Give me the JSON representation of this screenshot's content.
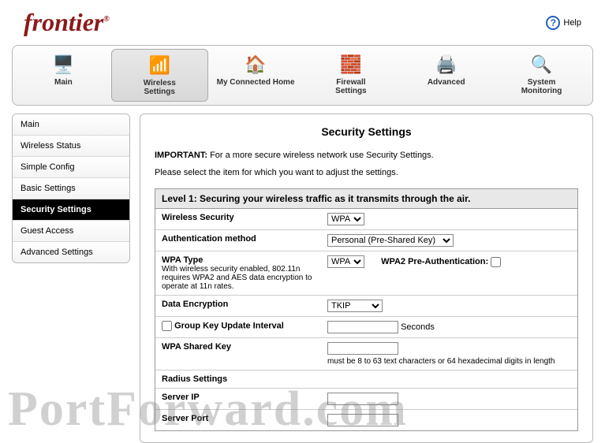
{
  "brand": "frontier",
  "help_label": "Help",
  "topnav": [
    {
      "label": "Main",
      "icon": "🖥️"
    },
    {
      "label": "Wireless\nSettings",
      "icon": "📶"
    },
    {
      "label": "My Connected Home",
      "icon": "🏠"
    },
    {
      "label": "Firewall\nSettings",
      "icon": "🧱"
    },
    {
      "label": "Advanced",
      "icon": "🖨️"
    },
    {
      "label": "System\nMonitoring",
      "icon": "🔍"
    }
  ],
  "sidebar": {
    "items": [
      {
        "label": "Main"
      },
      {
        "label": "Wireless Status"
      },
      {
        "label": "Simple Config"
      },
      {
        "label": "Basic Settings"
      },
      {
        "label": "Security Settings"
      },
      {
        "label": "Guest Access"
      },
      {
        "label": "Advanced Settings"
      }
    ]
  },
  "page": {
    "title": "Security Settings",
    "important_prefix": "IMPORTANT:",
    "important_text": " For a more secure wireless network use Security Settings.",
    "subtext": "Please select the item for which you want to adjust the settings.",
    "panel_header": "Level 1: Securing your wireless traffic as it transmits through the air.",
    "rows": {
      "wireless_security": {
        "label": "Wireless Security",
        "value": "WPA"
      },
      "auth_method": {
        "label": "Authentication method",
        "value": "Personal (Pre-Shared Key)"
      },
      "wpa_type": {
        "label": "WPA Type",
        "hint": "With wireless security enabled, 802.11n requires WPA2 and AES data encryption to operate at 11n rates.",
        "value": "WPA",
        "preauth_label": "WPA2 Pre-Authentication:"
      },
      "data_encryption": {
        "label": "Data Encryption",
        "value": "TKIP"
      },
      "group_key": {
        "label": "Group Key Update Interval",
        "unit": "Seconds"
      },
      "shared_key": {
        "label": "WPA Shared Key",
        "hint": "must be 8 to 63 text characters or 64 hexadecimal digits in length"
      },
      "radius": {
        "title": "Radius Settings",
        "server_ip": "Server IP",
        "server_port": "Server Port"
      }
    }
  },
  "watermark": "PortForward.com"
}
